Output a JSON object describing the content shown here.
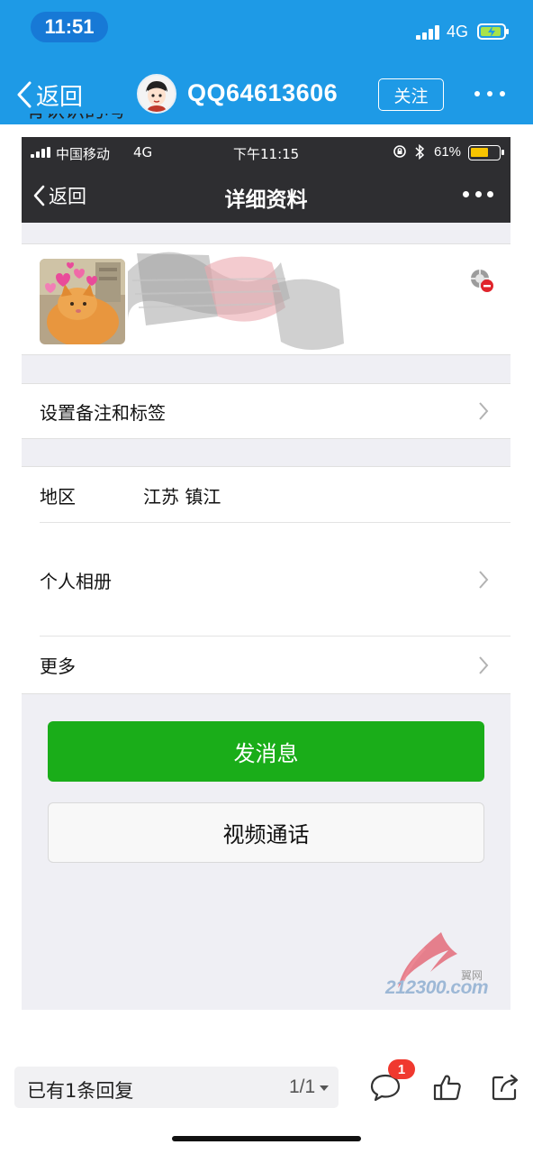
{
  "status_bar": {
    "time": "11:51",
    "network": "4G"
  },
  "header": {
    "back_label": "返回",
    "title": "QQ64613606",
    "follow_label": "关注"
  },
  "post_text_cut": "有认识的吗",
  "wechat_screenshot": {
    "status": {
      "carrier": "中国移动",
      "network": "4G",
      "time": "下午11:15",
      "battery": "61%"
    },
    "nav": {
      "back_label": "返回",
      "title": "详细资料"
    },
    "rows": {
      "remark_label": "设置备注和标签",
      "region_label": "地区",
      "region_value": "江苏 镇江",
      "album_label": "个人相册",
      "more_label": "更多"
    },
    "buttons": {
      "send_message": "发消息",
      "video_call": "视频通话"
    },
    "watermark": {
      "cn": "翼网",
      "en": "212300.com"
    }
  },
  "bottom_bar": {
    "reply_label": "已有1条回复",
    "page_indicator": "1/1",
    "comment_badge": "1"
  },
  "colors": {
    "app_header": "#1e9ae6",
    "wechat_nav": "#2e2e31",
    "wechat_green": "#1aad19",
    "badge_red": "#f0392f"
  },
  "icons": [
    "chevron-left-icon",
    "more-dots-icon",
    "signal-icon",
    "battery-icon",
    "bluetooth-icon",
    "rotation-lock-icon",
    "blocked-icon",
    "chevron-right-icon",
    "comment-icon",
    "thumbs-up-icon",
    "share-icon"
  ]
}
